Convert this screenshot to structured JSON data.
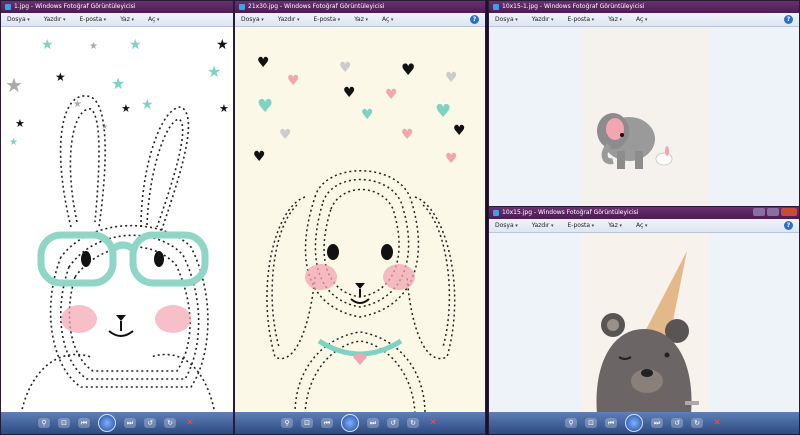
{
  "windows": [
    {
      "title": "1.jpg - Windows Fotoğraf Görüntüleyicisi",
      "menu": [
        "Dosya",
        "Yazdır",
        "E-posta",
        "Yaz",
        "Aç"
      ]
    },
    {
      "title": "21x30.jpg - Windows Fotoğraf Görüntüleyicisi",
      "menu": [
        "Dosya",
        "Yazdır",
        "E-posta",
        "Yaz",
        "Aç"
      ]
    },
    {
      "title": "10x15-1.jpg - Windows Fotoğraf Görüntüleyicisi",
      "menu": [
        "Dosya",
        "Yazdır",
        "E-posta",
        "Yaz",
        "Aç"
      ]
    },
    {
      "title": "10x15.jpg - Windows Fotoğraf Görüntüleyicisi",
      "menu": [
        "Dosya",
        "Yazdır",
        "E-posta",
        "Yaz",
        "Aç"
      ]
    }
  ],
  "help_label": "?",
  "colors": {
    "titlebar": "#5a2460",
    "toolbar": "#2c4a80",
    "mint": "#7fd3c3",
    "pink": "#f3a5b1",
    "cream": "#fbf8e8"
  },
  "icons": [
    "zoom-icon",
    "fit-icon",
    "prev-icon",
    "slideshow-icon",
    "next-icon",
    "rotate-left-icon",
    "rotate-right-icon",
    "delete-icon"
  ]
}
